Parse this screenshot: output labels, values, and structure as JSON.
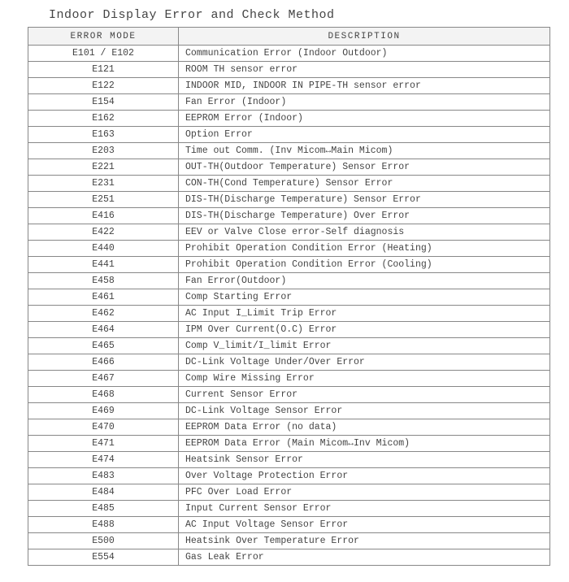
{
  "title": "Indoor Display Error and Check Method",
  "headers": {
    "code": "ERROR MODE",
    "desc": "DESCRIPTION"
  },
  "rows": [
    {
      "code": "E101 / E102",
      "desc": "Communication Error (Indoor Outdoor)"
    },
    {
      "code": "E121",
      "desc": "ROOM TH sensor error"
    },
    {
      "code": "E122",
      "desc": "INDOOR MID, INDOOR IN PIPE-TH sensor error"
    },
    {
      "code": "E154",
      "desc": "Fan Error (Indoor)"
    },
    {
      "code": "E162",
      "desc": "EEPROM Error (Indoor)"
    },
    {
      "code": "E163",
      "desc": "Option Error"
    },
    {
      "code": "E203",
      "desc": "Time out Comm. (Inv Micom↔Main Micom)"
    },
    {
      "code": "E221",
      "desc": "OUT-TH(Outdoor Temperature) Sensor Error"
    },
    {
      "code": "E231",
      "desc": "CON-TH(Cond Temperature) Sensor Error"
    },
    {
      "code": "E251",
      "desc": "DIS-TH(Discharge Temperature) Sensor Error"
    },
    {
      "code": "E416",
      "desc": "DIS-TH(Discharge Temperature) Over Error"
    },
    {
      "code": "E422",
      "desc": "EEV or Valve Close error-Self diagnosis"
    },
    {
      "code": "E440",
      "desc": "Prohibit Operation Condition Error (Heating)"
    },
    {
      "code": "E441",
      "desc": "Prohibit Operation Condition Error (Cooling)"
    },
    {
      "code": "E458",
      "desc": " Fan Error(Outdoor)"
    },
    {
      "code": "E461",
      "desc": "Comp Starting Error"
    },
    {
      "code": "E462",
      "desc": "AC Input I_Limit Trip Error"
    },
    {
      "code": "E464",
      "desc": "IPM Over Current(O.C) Error"
    },
    {
      "code": "E465",
      "desc": "Comp V_limit/I_limit Error"
    },
    {
      "code": "E466",
      "desc": "DC-Link Voltage Under/Over Error"
    },
    {
      "code": "E467",
      "desc": "Comp Wire Missing Error"
    },
    {
      "code": "E468",
      "desc": "Current Sensor Error"
    },
    {
      "code": "E469",
      "desc": "DC-Link Voltage Sensor Error"
    },
    {
      "code": "E470",
      "desc": "EEPROM Data Error (no data)"
    },
    {
      "code": "E471",
      "desc": "EEPROM Data Error (Main Micom↔Inv Micom)"
    },
    {
      "code": "E474",
      "desc": "Heatsink Sensor Error"
    },
    {
      "code": "E483",
      "desc": "Over Voltage Protection Error"
    },
    {
      "code": "E484",
      "desc": "PFC Over Load Error"
    },
    {
      "code": "E485",
      "desc": "Input Current Sensor Error"
    },
    {
      "code": "E488",
      "desc": "AC Input Voltage Sensor Error"
    },
    {
      "code": "E500",
      "desc": "Heatsink Over Temperature Error"
    },
    {
      "code": "E554",
      "desc": "Gas Leak Error"
    }
  ]
}
